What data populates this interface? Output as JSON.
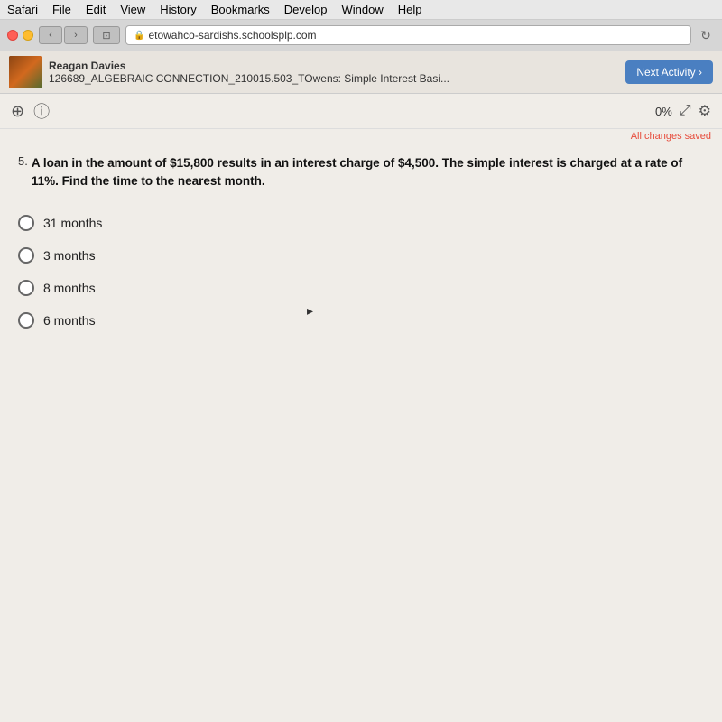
{
  "menubar": {
    "items": [
      "Safari",
      "File",
      "Edit",
      "View",
      "History",
      "Bookmarks",
      "Develop",
      "Window",
      "Help"
    ]
  },
  "browser": {
    "address": "etowahco-sardishs.schoolsplp.com",
    "nav_back": "‹",
    "nav_forward": "›",
    "tab_icon": "⊡",
    "refresh": "↻"
  },
  "user": {
    "name": "Reagan Davies",
    "course": "126689_ALGEBRAIC CONNECTION_210015.503_TOwens: Simple Interest Basi...",
    "next_button": "Next Activity ›"
  },
  "toolbar": {
    "print_icon": "⊕",
    "info_icon": "ⓘ",
    "progress": "0%",
    "fullscreen_icon": "⤢",
    "settings_icon": "⚙"
  },
  "status": {
    "changes_saved": "All changes saved"
  },
  "question": {
    "number": "5.",
    "text": "A loan in the amount of $15,800 results in an interest charge of $4,500. The simple interest is charged at a rate of 11%. Find the time to the nearest month.",
    "options": [
      {
        "id": "a",
        "label": "31 months"
      },
      {
        "id": "b",
        "label": "3 months"
      },
      {
        "id": "c",
        "label": "8 months"
      },
      {
        "id": "d",
        "label": "6 months"
      }
    ]
  }
}
